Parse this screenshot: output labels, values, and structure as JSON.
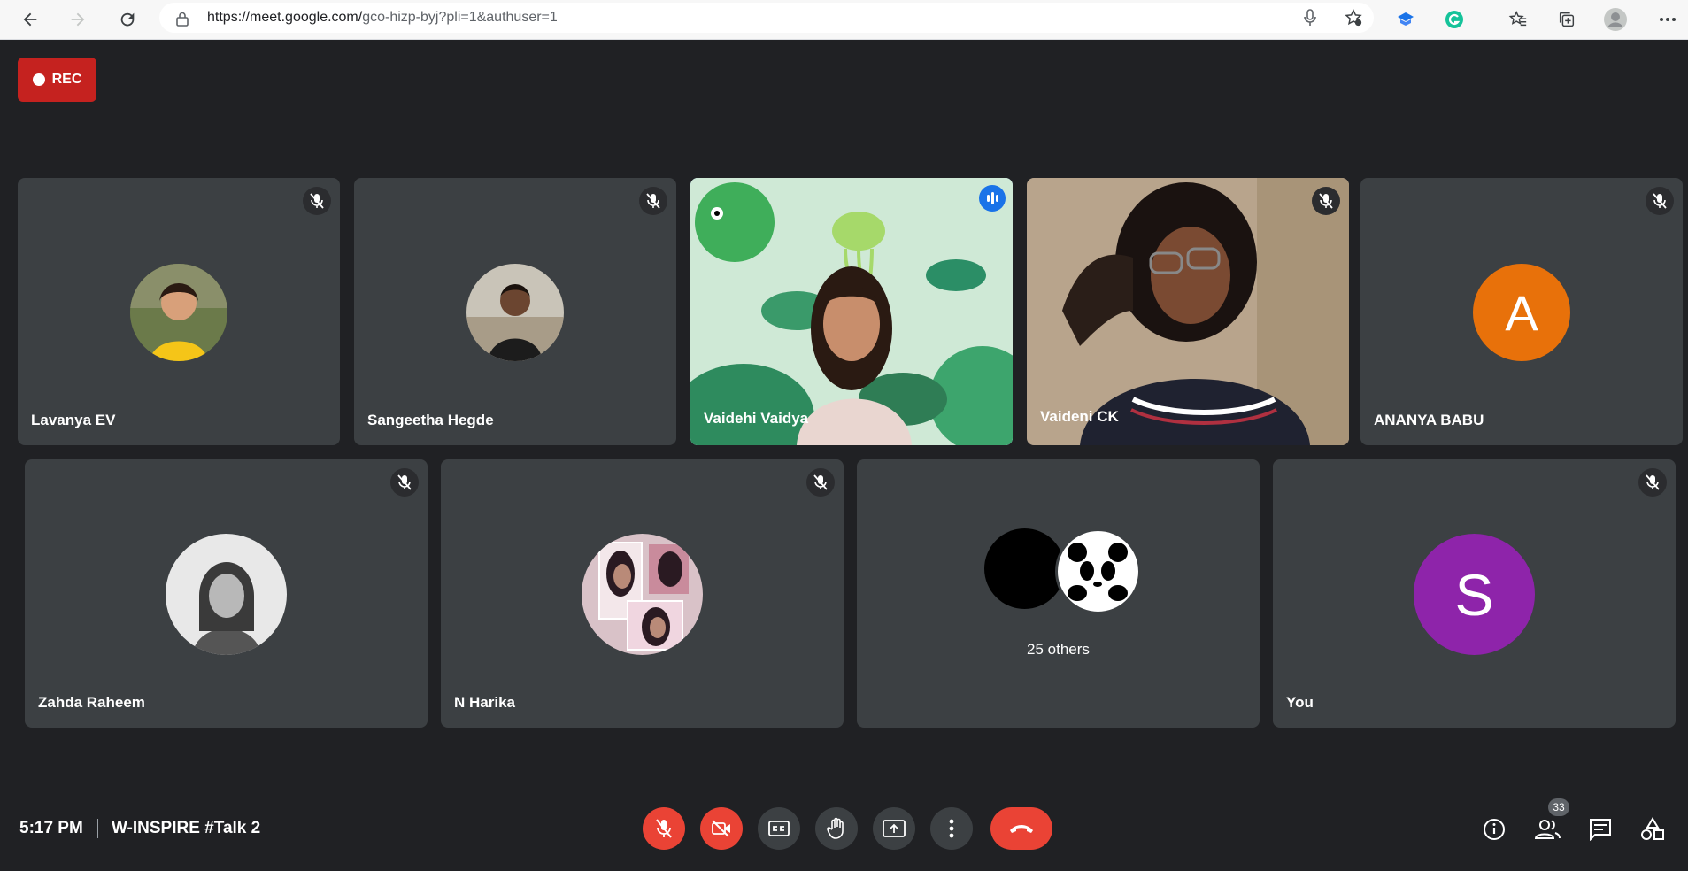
{
  "browser": {
    "url_host": "https://meet.google.com/",
    "url_path": "gco-hizp-byj?pli=1&authuser=1"
  },
  "recording": {
    "label": "REC"
  },
  "tiles": [
    {
      "name": "Lavanya EV"
    },
    {
      "name": "Sangeetha Hegde"
    },
    {
      "name": "Vaidehi Vaidya"
    },
    {
      "name": "Vaideni CK"
    },
    {
      "name": "ANANYA BABU",
      "initial": "A",
      "color": "#e8710a"
    },
    {
      "name": "Zahda Raheem"
    },
    {
      "name": "N Harika"
    },
    {
      "others": "25 others"
    },
    {
      "name": "You",
      "initial": "S",
      "color": "#8e24aa"
    }
  ],
  "footer": {
    "time": "5:17 PM",
    "meeting_title": "W-INSPIRE #Talk 2",
    "participant_count": "33"
  },
  "colors": {
    "background": "#202124",
    "tile": "#3c4043",
    "danger": "#ea4335",
    "accent": "#8ab4f8"
  }
}
